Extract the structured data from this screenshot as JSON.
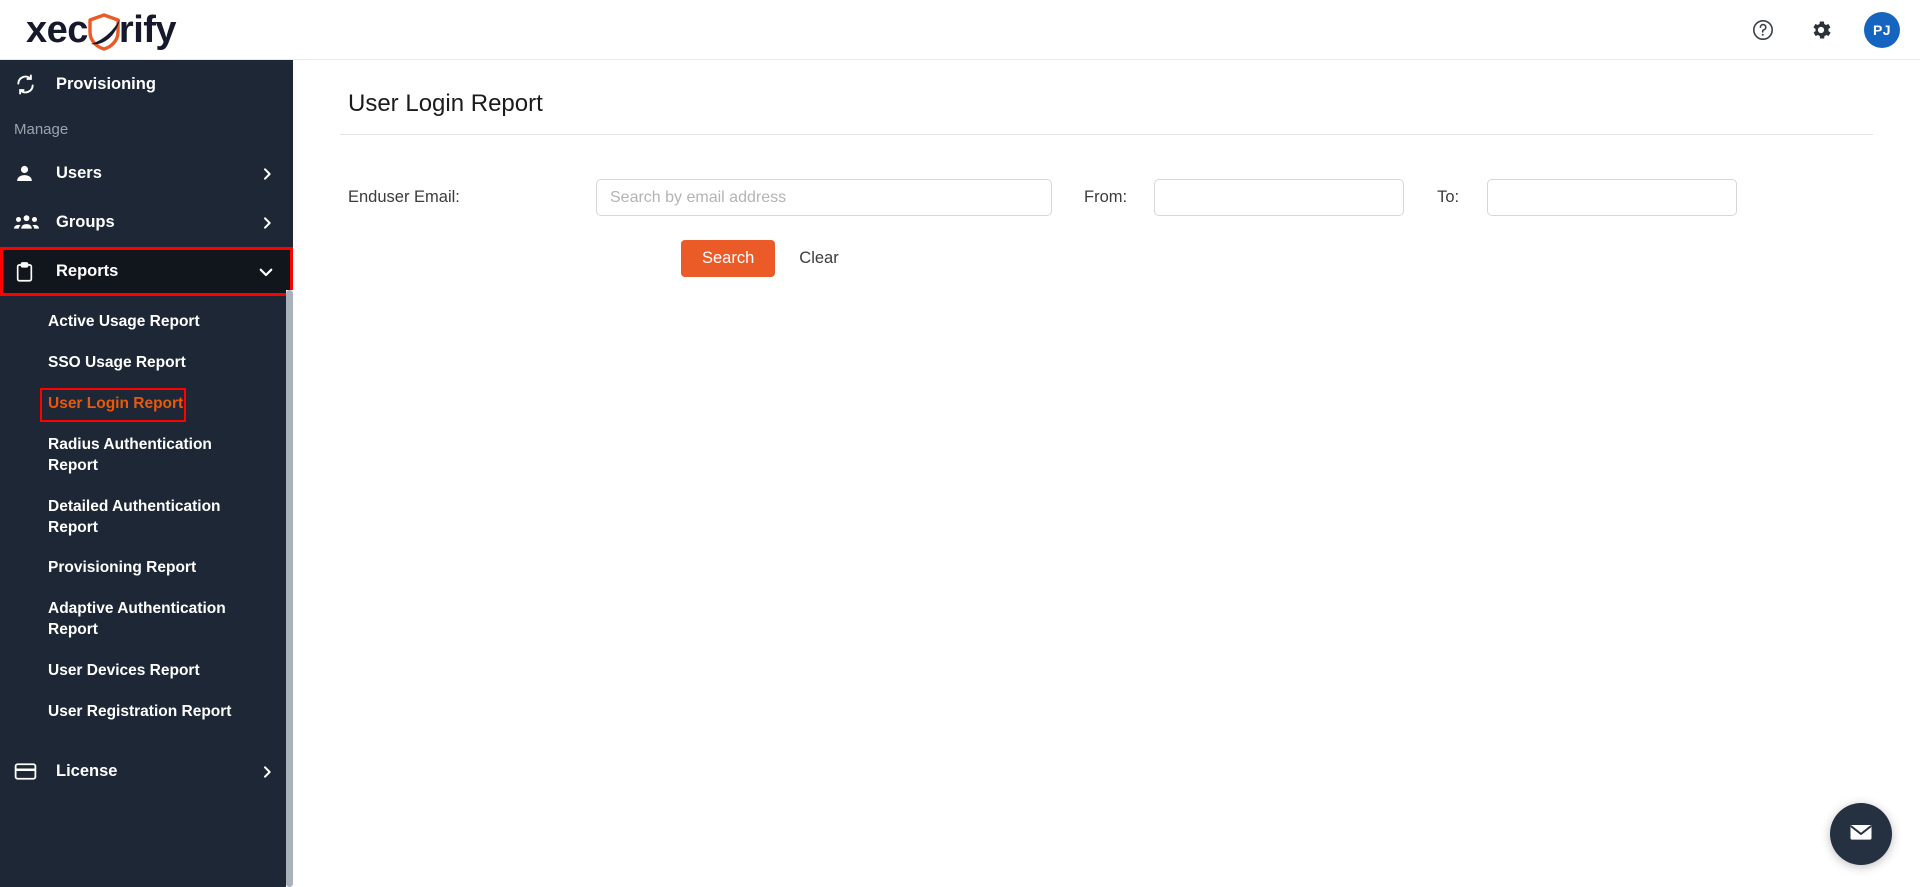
{
  "header": {
    "logo_text_before": "xec",
    "logo_text_after": "rify",
    "help_icon": "help-circle-icon",
    "settings_icon": "gear-icon",
    "avatar_initials": "PJ",
    "avatar_color": "#1565c0"
  },
  "sidebar": {
    "background": "#1d2735",
    "active_background": "#11161d",
    "selected_color": "#e8590c",
    "top_item": {
      "label": "Provisioning",
      "icon": "sync-arrows-icon"
    },
    "section_label": "Manage",
    "items": [
      {
        "label": "Users",
        "icon": "user-icon",
        "chevron": "chevron-right-icon"
      },
      {
        "label": "Groups",
        "icon": "users-group-icon",
        "chevron": "chevron-right-icon"
      },
      {
        "label": "Reports",
        "icon": "clipboard-icon",
        "chevron": "chevron-down-icon"
      }
    ],
    "reports_submenu": [
      {
        "label": "Active Usage Report",
        "selected": false
      },
      {
        "label": "SSO Usage Report",
        "selected": false
      },
      {
        "label": "User Login Report",
        "selected": true
      },
      {
        "label": "Radius Authentication Report",
        "selected": false
      },
      {
        "label": "Detailed Authentication Report",
        "selected": false
      },
      {
        "label": "Provisioning Report",
        "selected": false
      },
      {
        "label": "Adaptive Authentication Report",
        "selected": false
      },
      {
        "label": "User Devices Report",
        "selected": false
      },
      {
        "label": "User Registration Report",
        "selected": false
      }
    ],
    "bottom_item": {
      "label": "License",
      "icon": "credit-card-icon",
      "chevron": "chevron-right-icon"
    }
  },
  "main": {
    "page_title": "User Login Report",
    "filters": {
      "enduser_label": "Enduser Email:",
      "enduser_placeholder": "Search by email address",
      "enduser_value": "",
      "from_label": "From:",
      "from_value": "",
      "to_label": "To:",
      "to_value": ""
    },
    "buttons": {
      "search_label": "Search",
      "search_color": "#ea5b27",
      "clear_label": "Clear"
    }
  },
  "chat": {
    "icon": "envelope-icon",
    "color": "#253141"
  }
}
